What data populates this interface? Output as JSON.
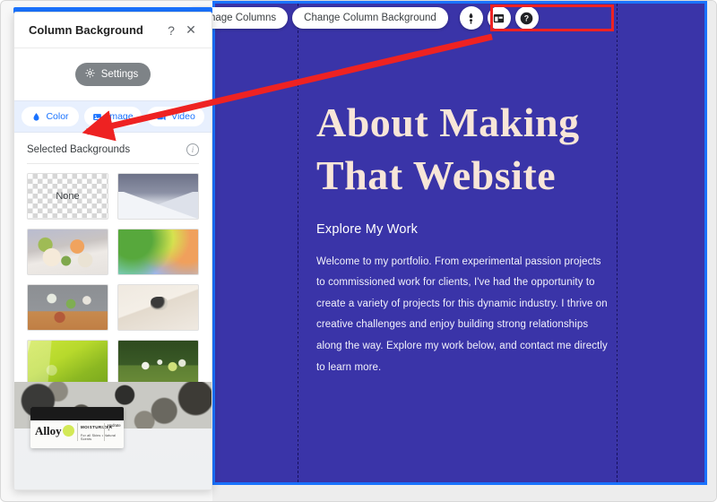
{
  "panel": {
    "title": "Column Background",
    "help_icon": "?",
    "close_icon": "✕",
    "settings_label": "Settings",
    "tabs": [
      {
        "label": "Color",
        "icon": "water-drop-icon",
        "active": true
      },
      {
        "label": "Image",
        "icon": "image-icon",
        "active": false
      },
      {
        "label": "Video",
        "icon": "video-camera-icon",
        "active": false
      }
    ],
    "selected_backgrounds_label": "Selected Backgrounds",
    "info_icon": "i",
    "thumbnails": [
      {
        "name": "none-swatch",
        "label": "None",
        "style": "checker"
      },
      {
        "name": "mountain-photo",
        "label": "",
        "style": "t-mountain"
      },
      {
        "name": "citrus-flatlay-photo",
        "label": "",
        "style": "t-citrus"
      },
      {
        "name": "gradient-blur-swatch",
        "label": "",
        "style": "t-gradient"
      },
      {
        "name": "tools-flatlay-photo",
        "label": "",
        "style": "t-flatlay"
      },
      {
        "name": "cream-product-photo",
        "label": "",
        "style": "t-cream"
      },
      {
        "name": "green-lit-photo",
        "label": "",
        "style": "t-greenlit"
      },
      {
        "name": "dark-green-product-photo",
        "label": "",
        "style": "t-darkgreen"
      }
    ],
    "product_preview": {
      "brand": "Alloy",
      "product_type": "MOISTURIZER",
      "tagline": "For all Skins • Natural Scents",
      "side_text": "Hydrate +"
    }
  },
  "toolbar": {
    "manage_columns_label": "Manage Columns",
    "change_background_label": "Change Column Background",
    "icon_buttons": [
      {
        "name": "color-picker-icon",
        "title": "Color"
      },
      {
        "name": "layout-columns-icon",
        "title": "Layout"
      },
      {
        "name": "help-circle-icon",
        "title": "Help"
      }
    ]
  },
  "canvas": {
    "background_color": "#3a34a8",
    "selection_border_color": "#1a73ff",
    "heading": "About Making That Website",
    "subtitle": "Explore My Work",
    "paragraph": "Welcome to my portfolio. From experimental passion projects to commissioned work for clients, I've had the opportunity to create a variety of projects for this dynamic industry. I thrive on creative challenges and enjoy building strong relationships along the way. Explore my work below, and contact me directly to learn more."
  },
  "annotations": {
    "highlight_color": "#ee2222",
    "arrow_from": "Change Column Background",
    "arrow_to": "Color"
  }
}
